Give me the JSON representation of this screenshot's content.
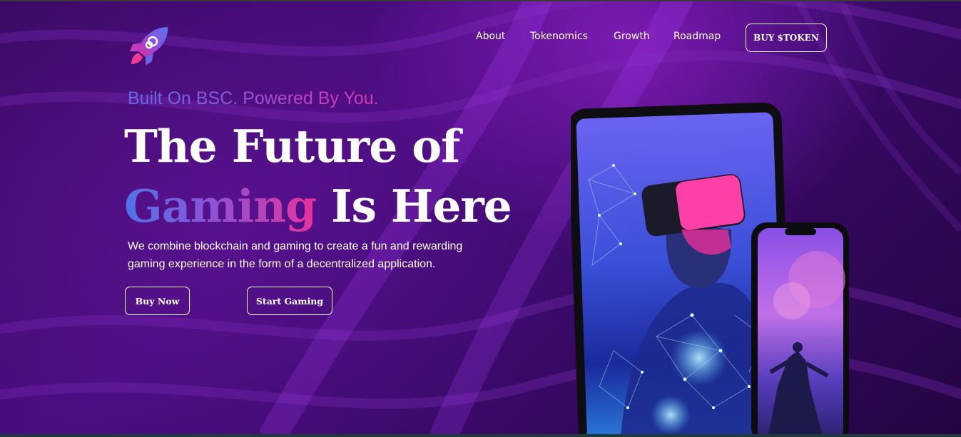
{
  "nav": {
    "logo_icon": "rocket-icon",
    "links": [
      {
        "label": "About"
      },
      {
        "label": "Tokenomics"
      },
      {
        "label": "Growth"
      },
      {
        "label": "Roadmap"
      }
    ],
    "cta_label": "BUY $TOKEN"
  },
  "hero": {
    "tagline": "Built On BSC. Powered By You.",
    "headline_line1": "The Future of",
    "headline_highlight": "Gaming",
    "headline_rest": "Is Here",
    "description": "We combine blockchain and gaming to create a fun and rewarding gaming experience in the form of a decentralized application.",
    "buttons": {
      "buy_now": "Buy Now",
      "start_gaming": "Start Gaming"
    }
  },
  "images": {
    "tablet": "tablet-vr-player-image",
    "phone": "phone-gamer-image"
  },
  "colors": {
    "background": "#3a0a63",
    "accent_blue": "#4f73e8",
    "accent_pink": "#e8319b",
    "text": "#ffffff"
  }
}
